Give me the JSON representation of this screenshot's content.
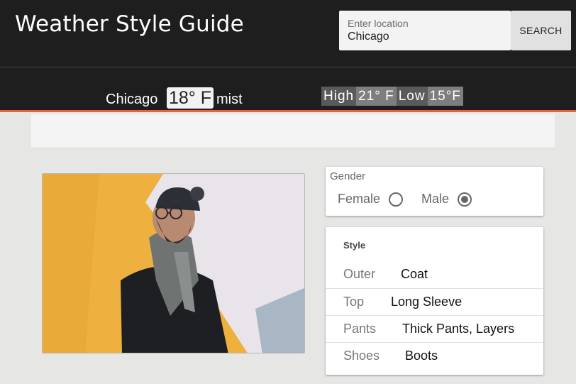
{
  "app": {
    "title": "Weather Style Guide"
  },
  "search": {
    "label": "Enter location",
    "value": "Chicago",
    "button_label": "SEARCH"
  },
  "weather": {
    "city": "Chicago",
    "temperature": "18° F",
    "condition": "mist",
    "high_label": "High",
    "high_value": "21° F",
    "low_label": "Low",
    "low_value": "15°F"
  },
  "gender": {
    "title": "Gender",
    "options": [
      {
        "label": "Female",
        "selected": false
      },
      {
        "label": "Male",
        "selected": true
      }
    ]
  },
  "style": {
    "title": "Style",
    "rows": [
      {
        "category": "Outer",
        "value": "Coat"
      },
      {
        "category": "Top",
        "value": "Long Sleeve"
      },
      {
        "category": "Pants",
        "value": "Thick Pants, Layers"
      },
      {
        "category": "Shoes",
        "value": "Boots"
      }
    ]
  },
  "colors": {
    "header_bg": "#1e1e1e",
    "accent": "#e8623c",
    "page_bg": "#e6e6e5"
  },
  "photo": {
    "icon": "person-in-winter-outfit-photo"
  }
}
